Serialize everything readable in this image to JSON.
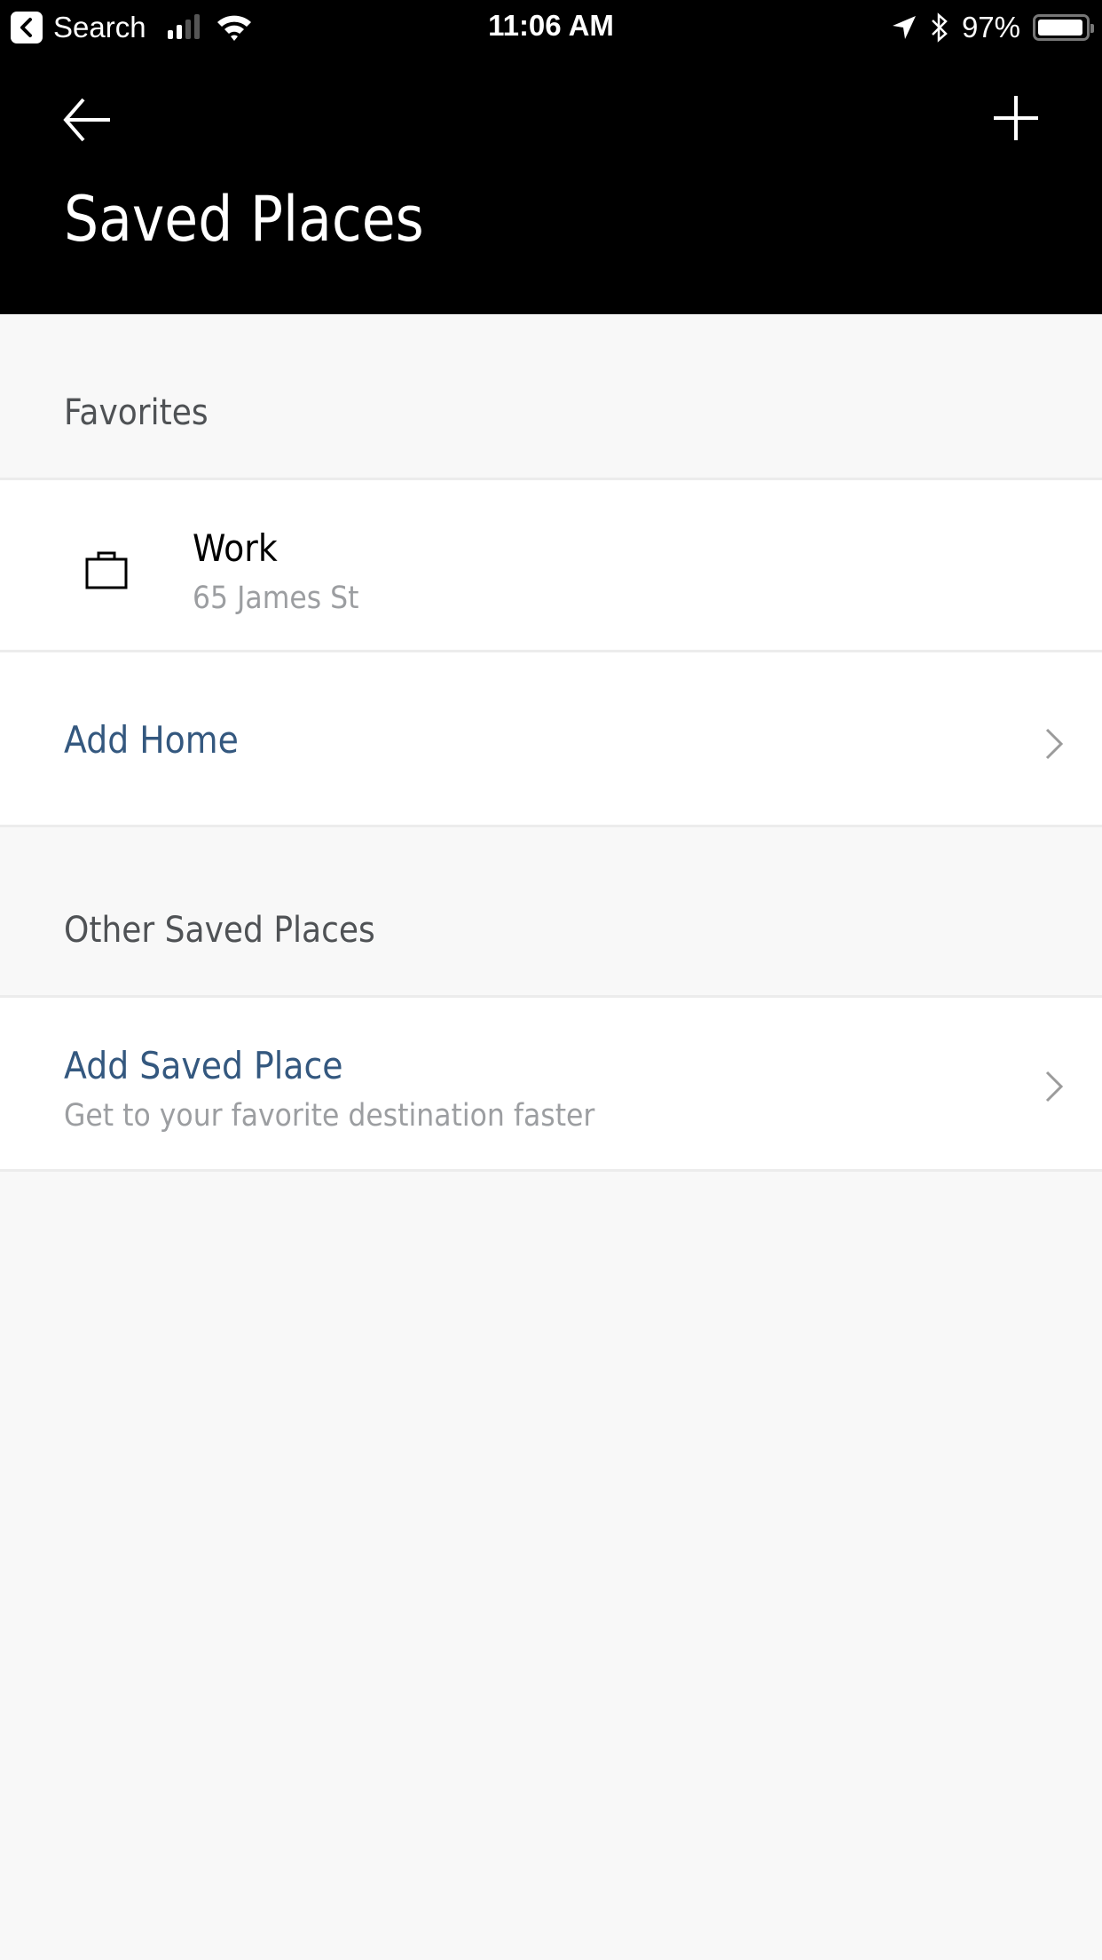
{
  "status_bar": {
    "back_app_label": "Search",
    "time": "11:06 AM",
    "battery_percent_label": "97%",
    "battery_level": 0.97,
    "signal_bars_active": 2,
    "signal_bars_total": 4
  },
  "header": {
    "title": "Saved Places",
    "back_icon": "arrow-left-icon",
    "add_icon": "plus-icon"
  },
  "favorites": {
    "section_label": "Favorites",
    "items": [
      {
        "icon": "briefcase-icon",
        "title": "Work",
        "subtitle": "65 James St"
      },
      {
        "title": "Add Home",
        "chevron": "chevron-right-icon"
      }
    ]
  },
  "other": {
    "section_label": "Other Saved Places",
    "items": [
      {
        "title": "Add Saved Place",
        "subtitle": "Get to your favorite destination faster",
        "chevron": "chevron-right-icon"
      }
    ]
  },
  "colors": {
    "header_bg": "#000000",
    "page_bg": "#f8f8f8",
    "link": "#34587f",
    "muted_text": "#9c9ea1",
    "section_text": "#4f5255",
    "divider": "#ececec"
  }
}
